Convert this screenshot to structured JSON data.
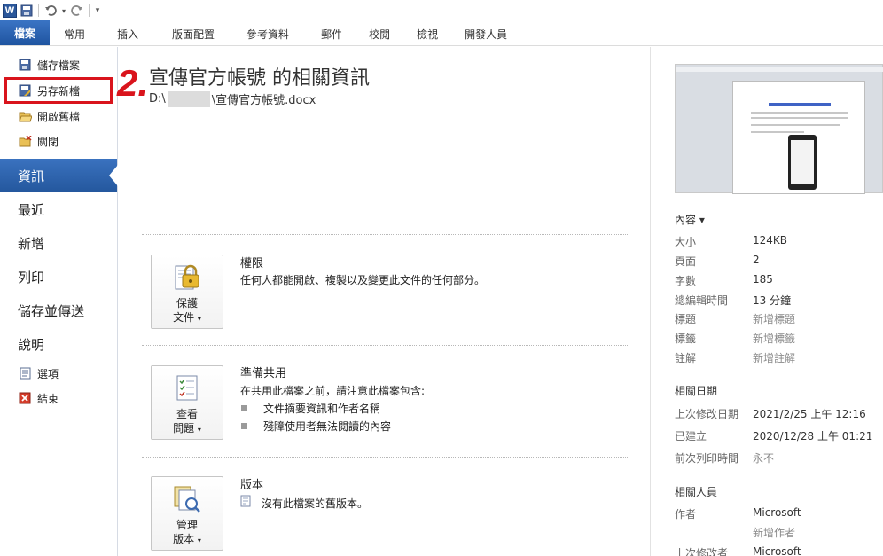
{
  "app": {
    "logo": "W",
    "qat_icons": [
      "save-icon",
      "undo-icon",
      "redo-icon",
      "customize-icon"
    ]
  },
  "tabs": [
    "檔案",
    "常用",
    "插入",
    "版面配置",
    "參考資料",
    "郵件",
    "校閱",
    "檢視",
    "開發人員"
  ],
  "sidebar": {
    "commands": [
      {
        "label": "儲存檔案",
        "icon": "save-icon"
      },
      {
        "label": "另存新檔",
        "icon": "save-as-icon"
      },
      {
        "label": "開啟舊檔",
        "icon": "open-folder-icon"
      },
      {
        "label": "關閉",
        "icon": "close-folder-icon"
      }
    ],
    "sections": [
      "資訊",
      "最近",
      "新增",
      "列印",
      "儲存並傳送",
      "說明"
    ],
    "bottom": [
      {
        "label": "選項",
        "icon": "options-icon"
      },
      {
        "label": "結束",
        "icon": "exit-icon"
      }
    ]
  },
  "annotation": {
    "step": "2."
  },
  "info": {
    "title": "宣傳官方帳號 的相關資訊",
    "path_prefix": "D:\\",
    "path_suffix": "\\宣傳官方帳號.docx"
  },
  "sections": {
    "permissions": {
      "button_line1": "保護",
      "button_line2": "文件",
      "title": "權限",
      "desc": "任何人都能開啟、複製以及變更此文件的任何部分。"
    },
    "prepare": {
      "button_line1": "查看",
      "button_line2": "問題",
      "title": "準備共用",
      "desc": "在共用此檔案之前，請注意此檔案包含:",
      "bullets": [
        "文件摘要資訊和作者名稱",
        "殘障使用者無法閱讀的內容"
      ]
    },
    "versions": {
      "button_line1": "管理",
      "button_line2": "版本",
      "title": "版本",
      "desc": "沒有此檔案的舊版本。"
    }
  },
  "properties": {
    "header": "內容 ▾",
    "rows": [
      {
        "k": "大小",
        "v": "124KB"
      },
      {
        "k": "頁面",
        "v": "2"
      },
      {
        "k": "字數",
        "v": "185"
      },
      {
        "k": "總編輯時間",
        "v": "13 分鐘"
      },
      {
        "k": "標題",
        "v": "新增標題"
      },
      {
        "k": "標籤",
        "v": "新增標籤"
      },
      {
        "k": "註解",
        "v": "新增註解"
      }
    ]
  },
  "dates": {
    "header": "相關日期",
    "rows": [
      {
        "k": "上次修改日期",
        "v": "2021/2/25 上午 12:16"
      },
      {
        "k": "已建立",
        "v": "2020/12/28 上午 01:21"
      },
      {
        "k": "前次列印時間",
        "v": "永不"
      }
    ]
  },
  "people": {
    "header": "相關人員",
    "author_label": "作者",
    "author": "Microsoft",
    "add_author": "新增作者",
    "last_modified_label": "上次修改者",
    "last_modified": "Microsoft"
  },
  "colors": {
    "accent": "#2b62ad",
    "highlight": "#d9141c"
  }
}
